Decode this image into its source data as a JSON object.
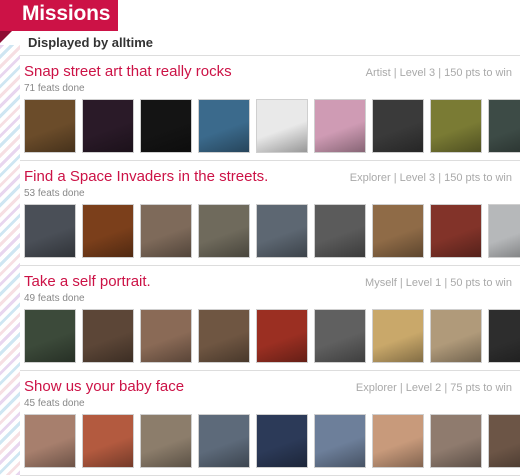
{
  "header": {
    "title": "Missions",
    "subtitle": "Displayed by alltime"
  },
  "missions": [
    {
      "title": "Snap street art that really rocks",
      "feats": "71 feats done",
      "meta": "Artist | Level 3 | 150 pts to win",
      "thumbs": [
        "#6b4c2a",
        "#2a1a28",
        "#141414",
        "#3b6a8c",
        "#e9e9e9",
        "#cf9bb4",
        "#3a3a3a",
        "#7a7b34",
        "#3d4b46",
        "#3e6e8a"
      ]
    },
    {
      "title": "Find a Space Invaders in the streets.",
      "feats": "53 feats done",
      "meta": "Explorer | Level 3 | 150 pts to win",
      "thumbs": [
        "#4a4f57",
        "#7b3f1b",
        "#7e6a5a",
        "#6f6a5c",
        "#5d6772",
        "#5b5b5b",
        "#8f6b47",
        "#823329",
        "#b6b8ba",
        "#4f4a44"
      ]
    },
    {
      "title": "Take a self portrait.",
      "feats": "49 feats done",
      "meta": "Myself | Level 1 | 50 pts to win",
      "thumbs": [
        "#3c4a3a",
        "#5c4637",
        "#8a6a56",
        "#6f5642",
        "#9b2f22",
        "#606060",
        "#c9a86a",
        "#b09a7a",
        "#2d2d2d",
        "#7b6a5b"
      ]
    },
    {
      "title": "Show us your baby face",
      "feats": "45 feats done",
      "meta": "Explorer | Level 2 | 75 pts to win",
      "thumbs": [
        "#a77f6d",
        "#b35a3f",
        "#8c7d6b",
        "#5d6a7a",
        "#2c3a58",
        "#6d7f9a",
        "#c89a7b",
        "#8f7b6e",
        "#6c5546",
        "#ad8a72"
      ]
    }
  ]
}
